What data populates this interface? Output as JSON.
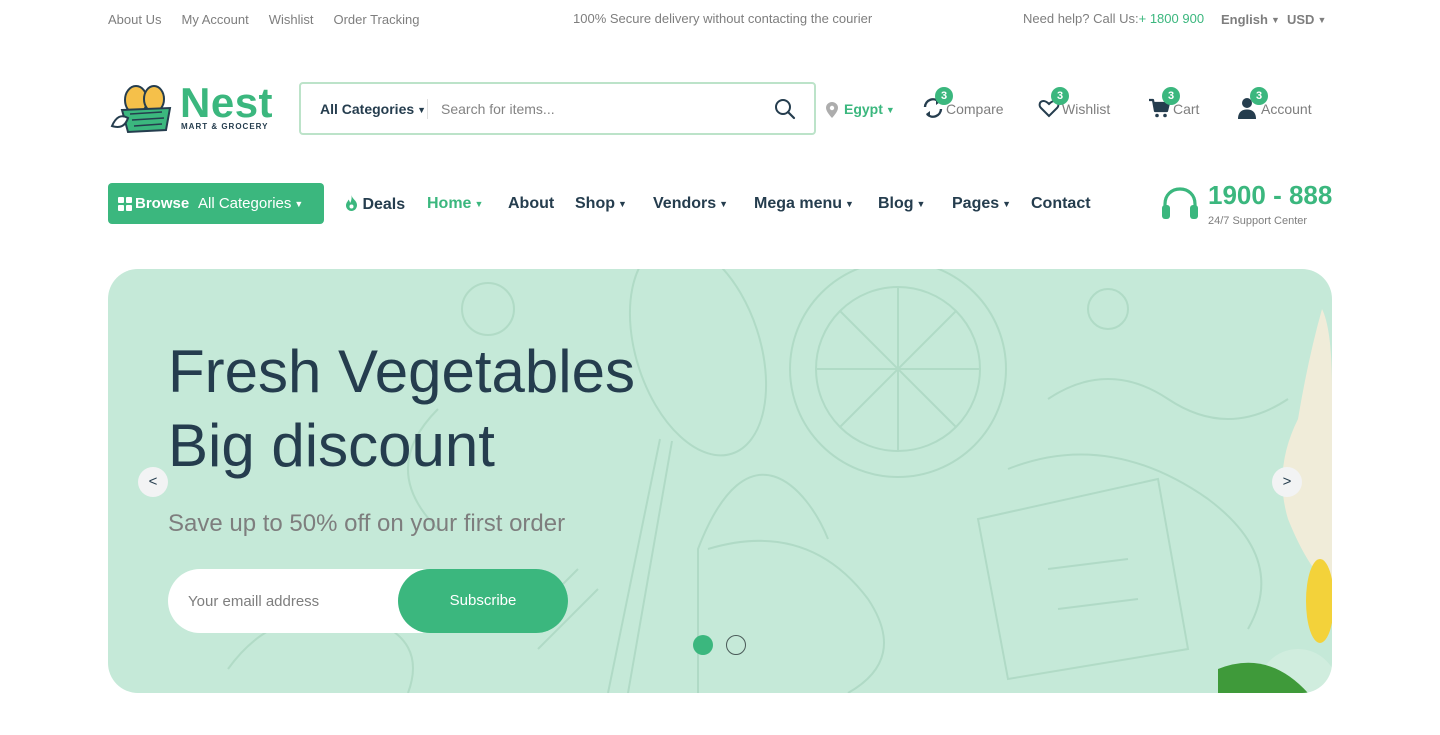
{
  "colors": {
    "brand": "#3bb77e",
    "heading": "#253d4e",
    "muted": "#7e7e7e",
    "hero_bg": "#c5e9d8"
  },
  "topbar": {
    "links": [
      "About Us",
      "My Account",
      "Wishlist",
      "Order Tracking"
    ],
    "promo": "100% Secure delivery without contacting the courier",
    "help_label": "Need help? Call Us:",
    "help_phone": "+ 1800 900",
    "language": "English",
    "currency": "USD"
  },
  "logo": {
    "name": "Nest",
    "tagline": "MART & GROCERY"
  },
  "search": {
    "category": "All Categories",
    "placeholder": "Search for items...",
    "icon": "search-icon"
  },
  "location": {
    "value": "Egypt",
    "icon": "map-pin-icon"
  },
  "header_actions": [
    {
      "label": "Compare",
      "count": "3",
      "icon": "compare-icon"
    },
    {
      "label": "Wishlist",
      "count": "3",
      "icon": "heart-icon"
    },
    {
      "label": "Cart",
      "count": "3",
      "icon": "cart-icon"
    },
    {
      "label": "Account",
      "count": "3",
      "icon": "user-icon"
    }
  ],
  "browse": {
    "label_bold": "Browse",
    "label": "All Categories",
    "icon": "grid-icon"
  },
  "nav": {
    "deals": "Deals",
    "home": "Home",
    "about": "About",
    "shop": "Shop",
    "vendors": "Vendors",
    "mega_menu": "Mega menu",
    "blog": "Blog",
    "pages": "Pages",
    "contact": "Contact",
    "active": "Home"
  },
  "support": {
    "phone": "1900 - 888",
    "label": "24/7 Support Center",
    "icon": "headset-icon"
  },
  "hero": {
    "title_line1": "Fresh Vegetables",
    "title_line2": "Big discount",
    "subtitle": "Save up to 50% off on your first order",
    "email_placeholder": "Your emaill address",
    "subscribe_label": "Subscribe",
    "prev": "<",
    "next": ">",
    "slides": 2,
    "active_slide": 1
  }
}
